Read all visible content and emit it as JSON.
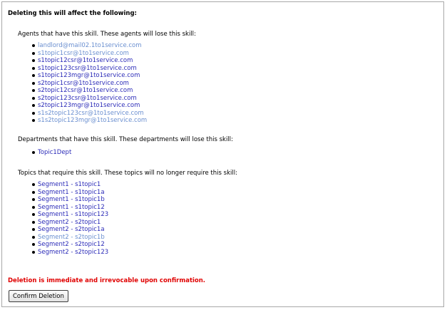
{
  "heading": "Deleting this will affect the following:",
  "agents": {
    "title": "Agents that have this skill. These agents will lose this skill:",
    "items": [
      {
        "label": "landlord@mail02.1to1service.com",
        "visited": true
      },
      {
        "label": "s1topic1csr@1to1service.com",
        "visited": true
      },
      {
        "label": "s1topic12csr@1to1service.com",
        "visited": false
      },
      {
        "label": "s1topic123csr@1to1service.com",
        "visited": false
      },
      {
        "label": "s1topic123mgr@1to1service.com",
        "visited": false
      },
      {
        "label": "s2topic1csr@1to1service.com",
        "visited": false
      },
      {
        "label": "s2topic12csr@1to1service.com",
        "visited": false
      },
      {
        "label": "s2topic123csr@1to1service.com",
        "visited": false
      },
      {
        "label": "s2topic123mgr@1to1service.com",
        "visited": false
      },
      {
        "label": "s1s2topic123csr@1to1service.com",
        "visited": true
      },
      {
        "label": "s1s2topic123mgr@1to1service.com",
        "visited": true
      }
    ]
  },
  "departments": {
    "title": "Departments that have this skill. These departments will lose this skill:",
    "items": [
      {
        "label": "Topic1Dept",
        "visited": false
      }
    ]
  },
  "topics": {
    "title": "Topics that require this skill. These topics will no longer require this skill:",
    "items": [
      {
        "label": "Segment1 - s1topic1",
        "visited": false
      },
      {
        "label": "Segment1 - s1topic1a",
        "visited": false
      },
      {
        "label": "Segment1 - s1topic1b",
        "visited": false
      },
      {
        "label": "Segment1 - s1topic12",
        "visited": false
      },
      {
        "label": "Segment1 - s1topic123",
        "visited": false
      },
      {
        "label": "Segment2 - s2topic1",
        "visited": false
      },
      {
        "label": "Segment2 - s2topic1a",
        "visited": false
      },
      {
        "label": "Segment2 - s2topic1b",
        "visited": true
      },
      {
        "label": "Segment2 - s2topic12",
        "visited": false
      },
      {
        "label": "Segment2 - s2topic123",
        "visited": false
      }
    ]
  },
  "warning": "Deletion is immediate and irrevocable upon confirmation.",
  "confirm_button": "Confirm Deletion",
  "colors": {
    "link": "#2b2bb8",
    "link_visited": "#6a8fd0",
    "warning": "#e00000"
  }
}
